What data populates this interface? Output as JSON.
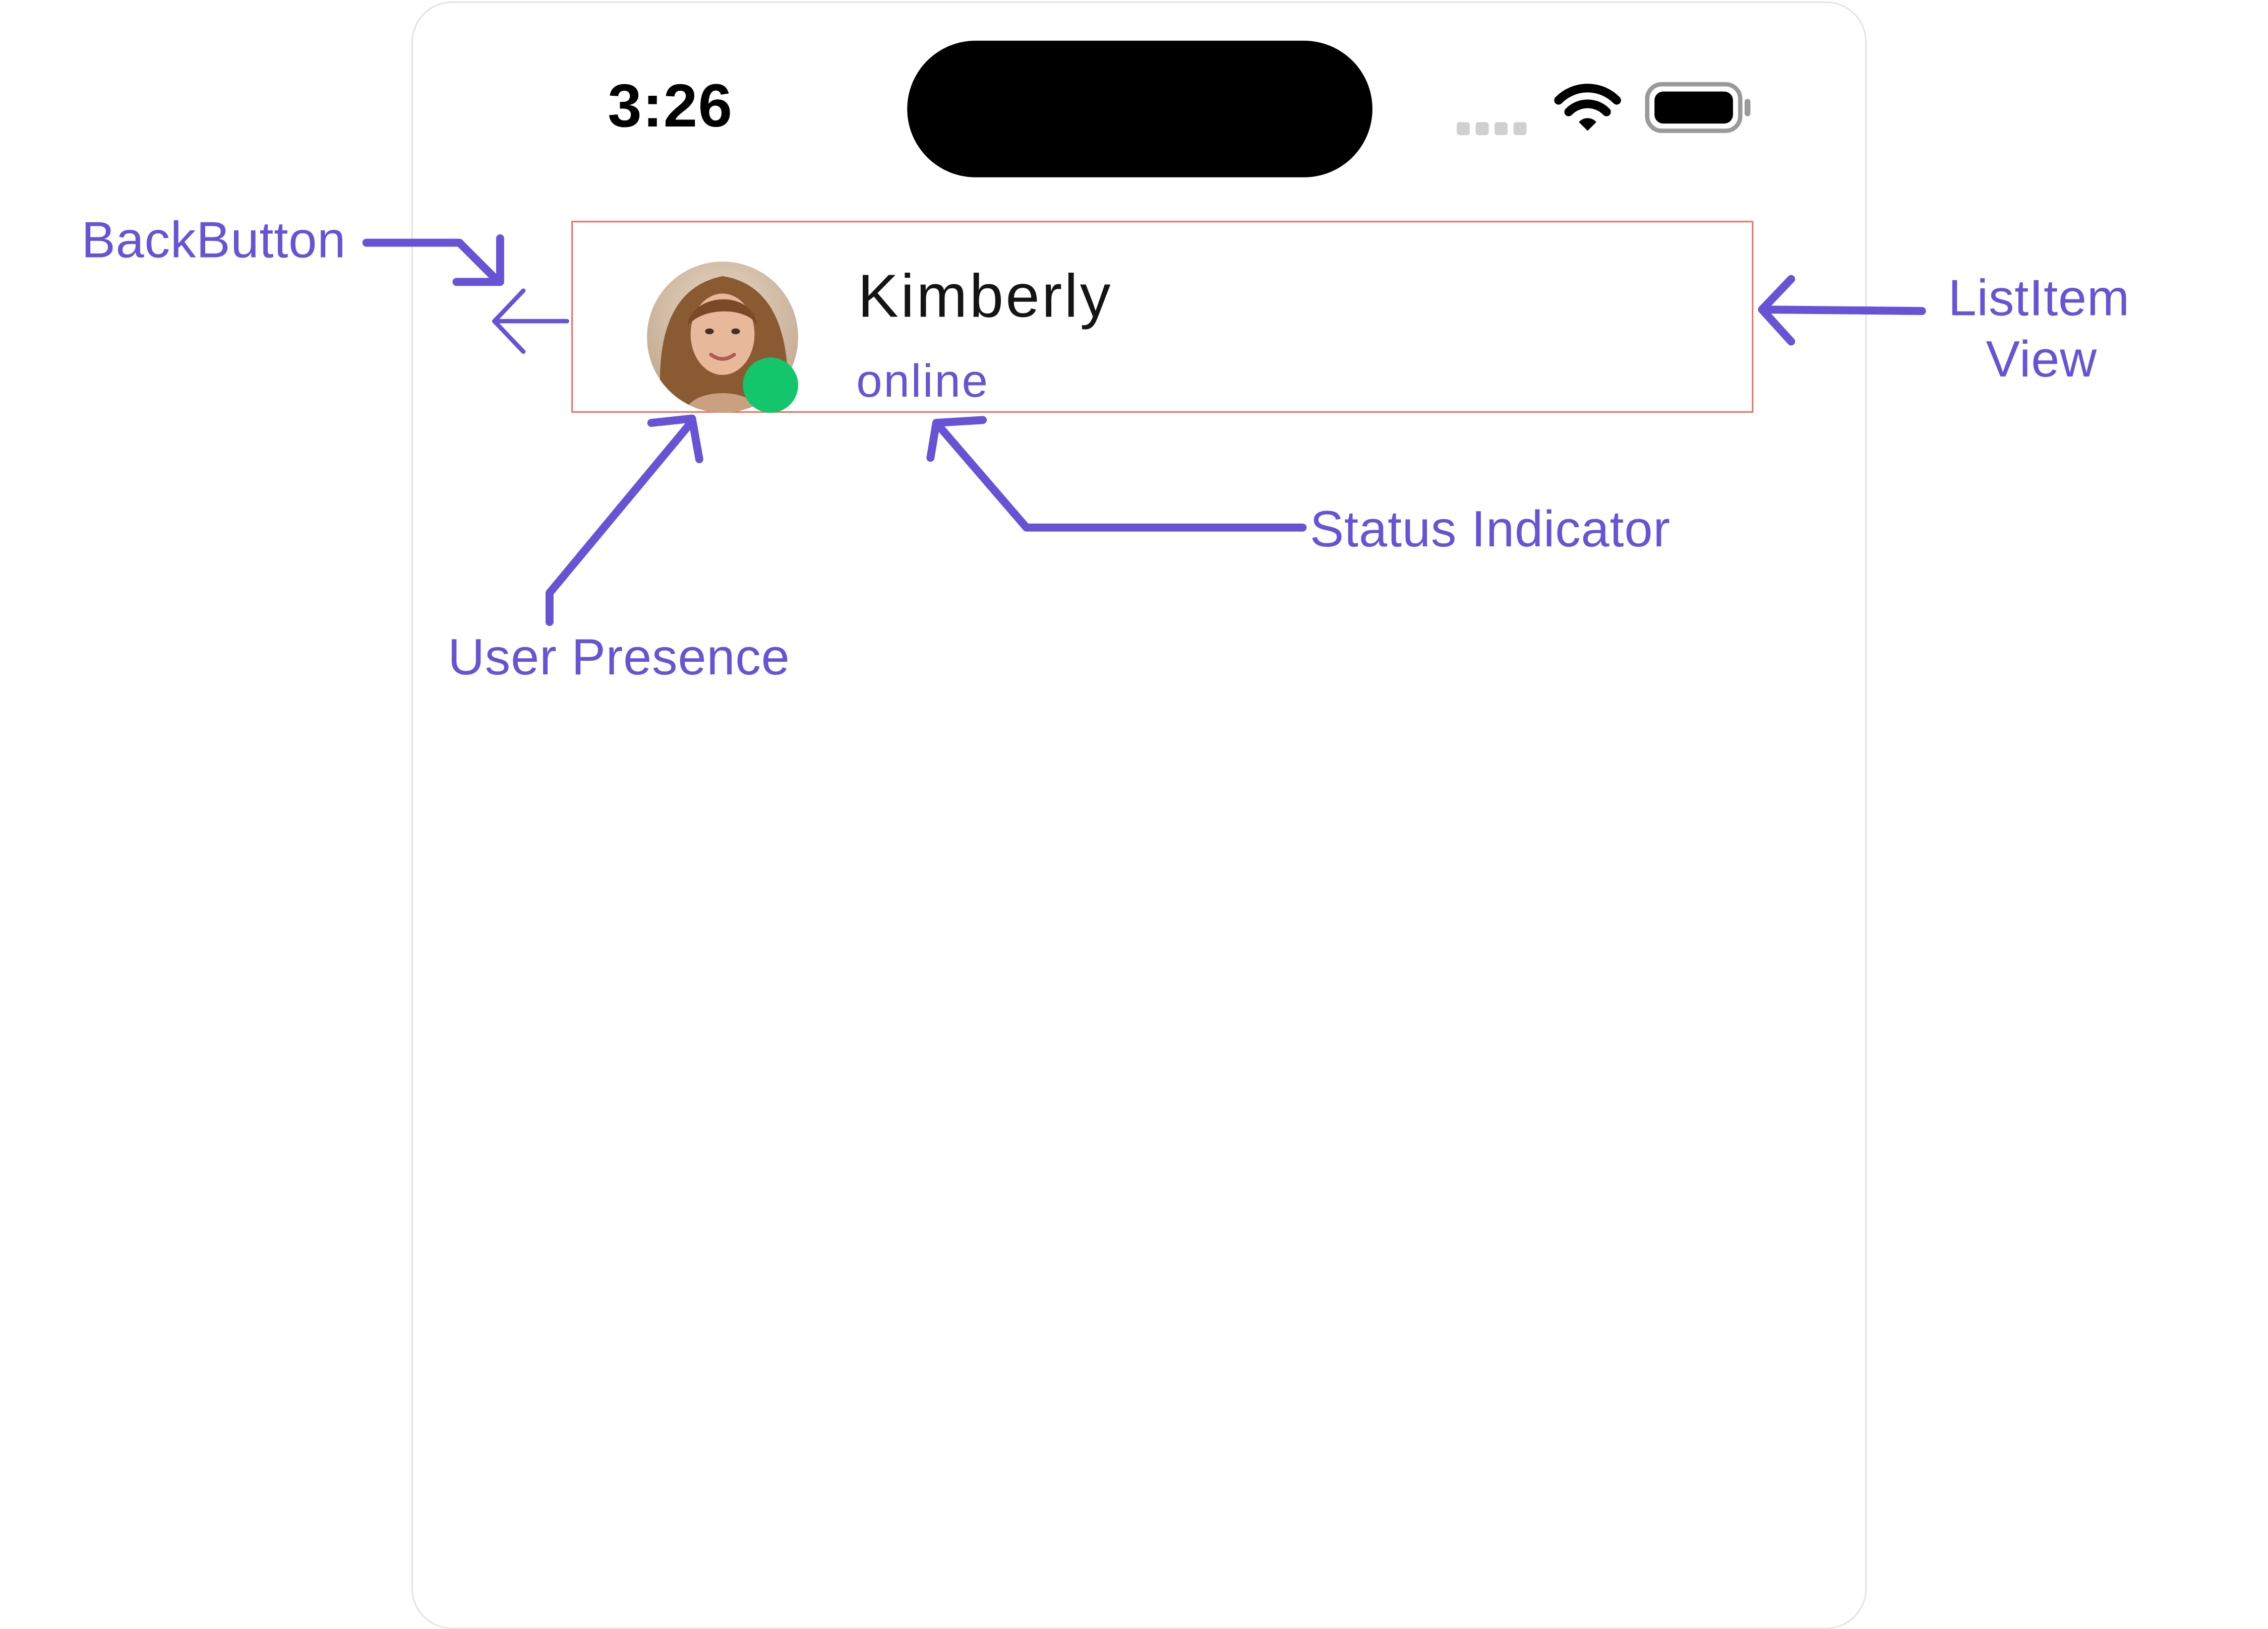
{
  "status_bar": {
    "time": "3:26",
    "icons": [
      "cellular-signal-icon",
      "wifi-icon",
      "battery-icon"
    ]
  },
  "header": {
    "back_icon": "arrow-left-icon",
    "user": {
      "name": "Kimberly",
      "status": "online",
      "presence_color": "#13c56b",
      "avatar": "user-avatar"
    }
  },
  "annotations": {
    "back_button": "BackButton",
    "list_item_line1": "ListItem",
    "list_item_line2": "View",
    "status_indicator": "Status Indicator",
    "user_presence": "User Presence"
  },
  "colors": {
    "accent": "#6852d6",
    "highlight_border": "#f06a55",
    "presence_online": "#13c56b"
  }
}
